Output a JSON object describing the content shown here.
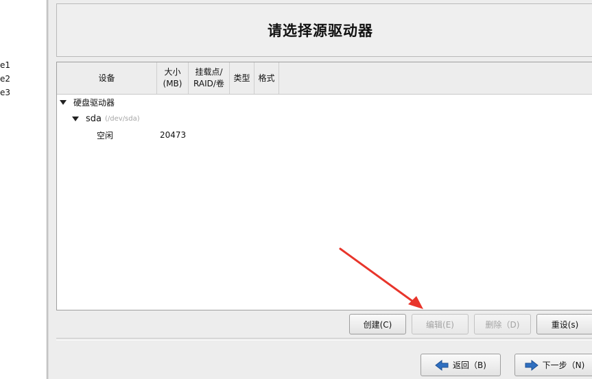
{
  "sidebar": {
    "items": [
      "e1",
      "e2",
      "e3"
    ]
  },
  "title": "请选择源驱动器",
  "table": {
    "headers": [
      "设备",
      "大小\n(MB)",
      "挂载点/\nRAID/卷",
      "类型",
      "格式"
    ],
    "rows": [
      {
        "device": "硬盘驱动器",
        "size": "",
        "sub": ""
      },
      {
        "device": "sda",
        "size": "",
        "sub": "(/dev/sda)"
      },
      {
        "device": "空闲",
        "size": "20473",
        "sub": ""
      }
    ]
  },
  "actions": {
    "create": "创建(C)",
    "edit": "编辑(E)",
    "delete": "删除（D)",
    "reset": "重设(s)"
  },
  "nav": {
    "back": "返回（B)",
    "next": "下一步（N)"
  },
  "colors": {
    "annotation_arrow": "#e8352b",
    "nav_icon": "#2f6fc0"
  },
  "icons": [
    "arrow-left-icon",
    "arrow-right-icon",
    "expand-triangle-icon"
  ]
}
